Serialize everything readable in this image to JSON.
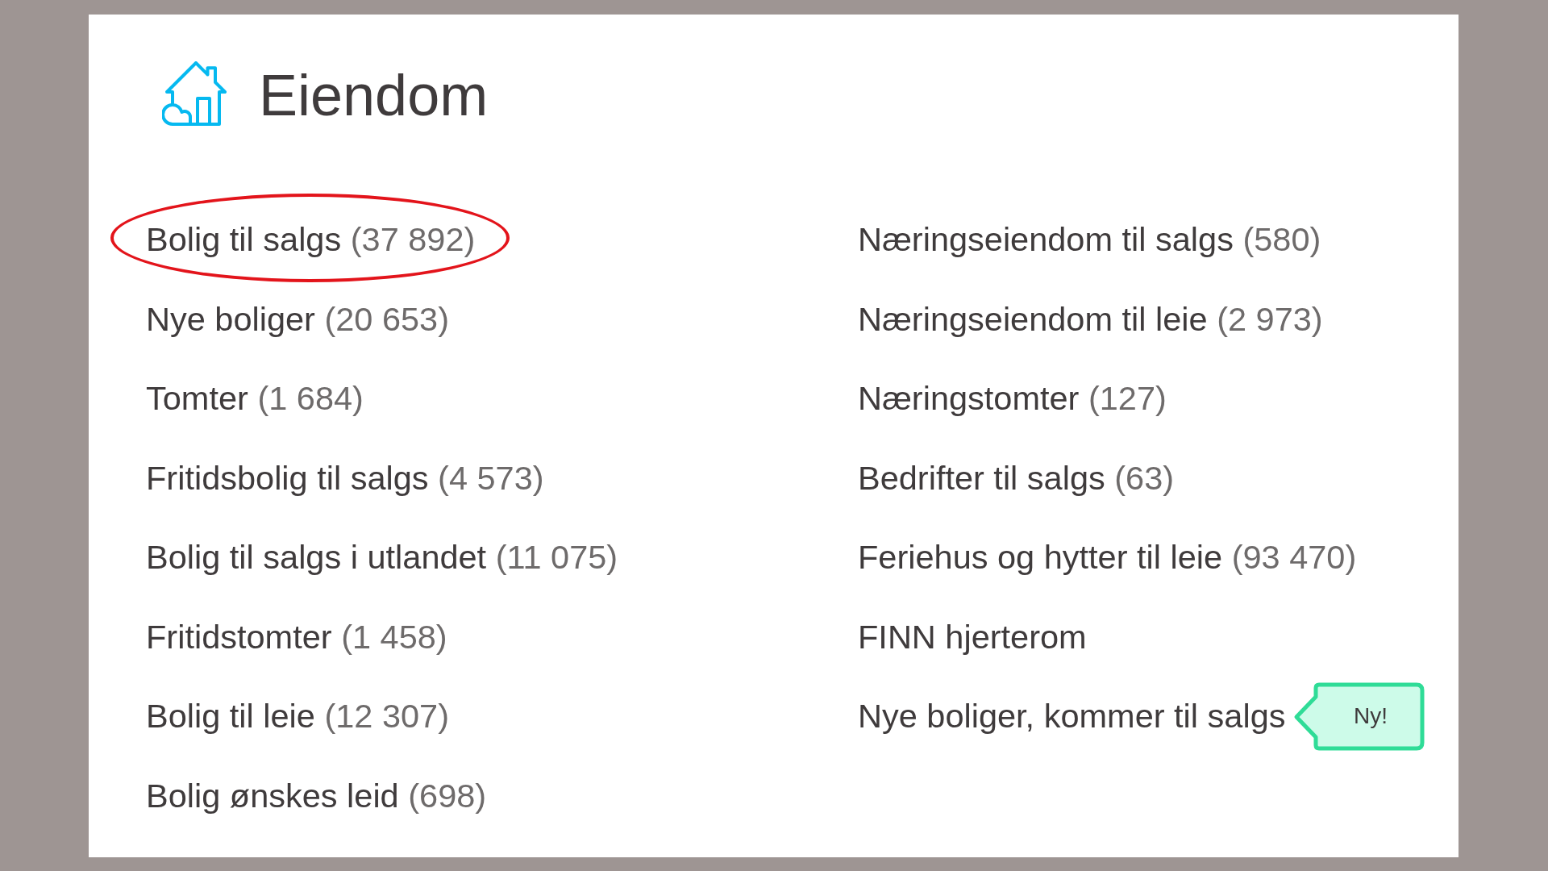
{
  "header": {
    "title": "Eiendom"
  },
  "columns": [
    {
      "links": [
        {
          "label": "Bolig til salgs",
          "count": "(37 892)",
          "circled": true
        },
        {
          "label": "Nye boliger",
          "count": "(20 653)",
          "circled": false
        },
        {
          "label": "Tomter",
          "count": "(1 684)",
          "circled": false
        },
        {
          "label": "Fritidsbolig til salgs",
          "count": "(4 573)",
          "circled": false
        },
        {
          "label": "Bolig til salgs i utlandet",
          "count": "(11 075)",
          "circled": false
        },
        {
          "label": "Fritidstomter",
          "count": "(1 458)",
          "circled": false
        },
        {
          "label": "Bolig til leie",
          "count": "(12 307)",
          "circled": false
        },
        {
          "label": "Bolig ønskes leid",
          "count": "(698)",
          "circled": false
        }
      ]
    },
    {
      "links": [
        {
          "label": "Næringseiendom til salgs",
          "count": "(580)",
          "circled": false
        },
        {
          "label": "Næringseiendom til leie",
          "count": "(2 973)",
          "circled": false
        },
        {
          "label": "Næringstomter",
          "count": "(127)",
          "circled": false
        },
        {
          "label": "Bedrifter til salgs",
          "count": "(63)",
          "circled": false
        },
        {
          "label": "Feriehus og hytter til leie",
          "count": "(93 470)",
          "circled": false
        },
        {
          "label": "FINN hjerterom",
          "circled": false
        },
        {
          "label": "Nye boliger, kommer til salgs",
          "badge": "Ny!",
          "circled": false
        }
      ]
    }
  ]
}
